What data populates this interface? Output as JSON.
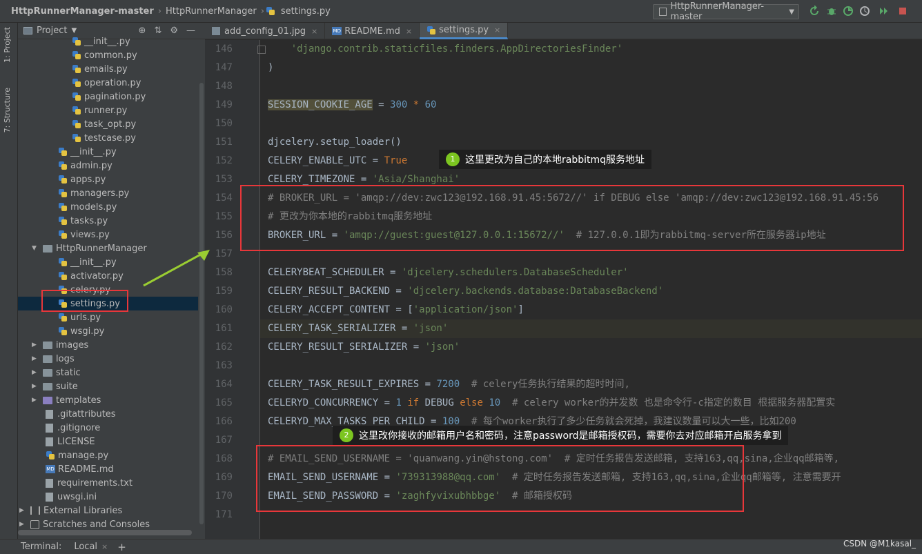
{
  "titlebar": {
    "breadcrumb": [
      "HttpRunnerManager-master",
      "HttpRunnerManager",
      "settings.py"
    ],
    "run_config": "HttpRunnerManager-master"
  },
  "left_strip": {
    "project_tab": "1: Project",
    "structure_tab": "7: Structure"
  },
  "project_panel": {
    "title": "Project",
    "items": [
      {
        "label": "__init__.py",
        "kind": "py",
        "indent": 78
      },
      {
        "label": "common.py",
        "kind": "py",
        "indent": 78
      },
      {
        "label": "emails.py",
        "kind": "py",
        "indent": 78
      },
      {
        "label": "operation.py",
        "kind": "py",
        "indent": 78
      },
      {
        "label": "pagination.py",
        "kind": "py",
        "indent": 78
      },
      {
        "label": "runner.py",
        "kind": "py",
        "indent": 78
      },
      {
        "label": "task_opt.py",
        "kind": "py",
        "indent": 78
      },
      {
        "label": "testcase.py",
        "kind": "py",
        "indent": 78
      },
      {
        "label": "__init__.py",
        "kind": "py",
        "indent": 58
      },
      {
        "label": "admin.py",
        "kind": "py",
        "indent": 58
      },
      {
        "label": "apps.py",
        "kind": "py",
        "indent": 58
      },
      {
        "label": "managers.py",
        "kind": "py",
        "indent": 58
      },
      {
        "label": "models.py",
        "kind": "py",
        "indent": 58
      },
      {
        "label": "tasks.py",
        "kind": "py",
        "indent": 58
      },
      {
        "label": "views.py",
        "kind": "py",
        "indent": 58
      },
      {
        "label": "HttpRunnerManager",
        "kind": "dir-open",
        "indent": 20
      },
      {
        "label": "__init__.py",
        "kind": "py",
        "indent": 58
      },
      {
        "label": "activator.py",
        "kind": "py",
        "indent": 58
      },
      {
        "label": "celery.py",
        "kind": "py",
        "indent": 58
      },
      {
        "label": "settings.py",
        "kind": "py",
        "indent": 58,
        "selected": true
      },
      {
        "label": "urls.py",
        "kind": "py",
        "indent": 58
      },
      {
        "label": "wsgi.py",
        "kind": "py",
        "indent": 58
      },
      {
        "label": "images",
        "kind": "dir",
        "indent": 20
      },
      {
        "label": "logs",
        "kind": "dir",
        "indent": 20
      },
      {
        "label": "static",
        "kind": "dir",
        "indent": 20
      },
      {
        "label": "suite",
        "kind": "dir",
        "indent": 20
      },
      {
        "label": "templates",
        "kind": "dir",
        "indent": 20
      },
      {
        "label": ".gitattributes",
        "kind": "file",
        "indent": 40
      },
      {
        "label": ".gitignore",
        "kind": "file",
        "indent": 40
      },
      {
        "label": "LICENSE",
        "kind": "file",
        "indent": 40
      },
      {
        "label": "manage.py",
        "kind": "py",
        "indent": 40
      },
      {
        "label": "README.md",
        "kind": "md",
        "indent": 40
      },
      {
        "label": "requirements.txt",
        "kind": "file",
        "indent": 40
      },
      {
        "label": "uwsgi.ini",
        "kind": "file",
        "indent": 40
      },
      {
        "label": "External Libraries",
        "kind": "lib",
        "indent": 2
      },
      {
        "label": "Scratches and Consoles",
        "kind": "scratch",
        "indent": 2
      }
    ]
  },
  "tabs": [
    {
      "label": "add_config_01.jpg",
      "icon": "image-icon"
    },
    {
      "label": "README.md",
      "icon": "markdown-icon"
    },
    {
      "label": "settings.py",
      "icon": "python-file-icon",
      "active": true
    }
  ],
  "editor": {
    "lines": [
      {
        "n": "146",
        "html": "    <span class=\"str\">'django.contrib.staticfiles.finders.AppDirectoriesFinder'</span>"
      },
      {
        "n": "147",
        "html": ")"
      },
      {
        "n": "148",
        "html": ""
      },
      {
        "n": "149",
        "html": "<span class=\"hl-bg\">SESSION_COOKIE_AGE</span> = <span class=\"num\">300</span> <span class=\"kw\">*</span> <span class=\"num\">60</span>"
      },
      {
        "n": "150",
        "html": ""
      },
      {
        "n": "151",
        "html": "djcelery.setup_loader()"
      },
      {
        "n": "152",
        "html": "CELERY_ENABLE_UTC = <span class=\"kw\">True</span>"
      },
      {
        "n": "153",
        "html": "CELERY_TIMEZONE = <span class=\"str\">'Asia/Shanghai'</span>"
      },
      {
        "n": "154",
        "html": "<span class=\"com\"># BROKER_URL = 'amqp://dev:zwc123@192.168.91.45:5672//' if DEBUG else 'amqp://dev:zwc123@192.168.91.45:56</span>"
      },
      {
        "n": "155",
        "html": "<span class=\"com\"># 更改为你本地的rabbitmq服务地址</span>"
      },
      {
        "n": "156",
        "html": "BROKER_URL = <span class=\"str\">'amqp://guest:guest@127.0.0.1:15672//'</span>  <span class=\"com\"># 127.0.0.1即为rabbitmq-server所在服务器ip地址</span>"
      },
      {
        "n": "157",
        "html": ""
      },
      {
        "n": "158",
        "html": "CELERYBEAT_SCHEDULER = <span class=\"str\">'djcelery.schedulers.DatabaseScheduler'</span>"
      },
      {
        "n": "159",
        "html": "CELERY_RESULT_BACKEND = <span class=\"str\">'djcelery.backends.database:DatabaseBackend'</span>"
      },
      {
        "n": "160",
        "html": "CELERY_ACCEPT_CONTENT = [<span class=\"str\">'application/json'</span>]"
      },
      {
        "n": "161",
        "html": "CELERY_TASK_SERIALIZER = <span class=\"str\">'json'</span>"
      },
      {
        "n": "162",
        "html": "CELERY_RESULT_SERIALIZER = <span class=\"str\">'json'</span>"
      },
      {
        "n": "163",
        "html": ""
      },
      {
        "n": "164",
        "html": "CELERY_TASK_RESULT_EXPIRES = <span class=\"num\">7200</span>  <span class=\"com\"># celery任务执行结果的超时时间,</span>"
      },
      {
        "n": "165",
        "html": "CELERYD_CONCURRENCY = <span class=\"num\">1</span> <span class=\"kw\">if</span> DEBUG <span class=\"kw\">else</span> <span class=\"num\">10</span>  <span class=\"com\"># celery worker的并发数 也是命令行-c指定的数目 根据服务器配置实</span>"
      },
      {
        "n": "166",
        "html": "CELERYD_MAX_TASKS_PER_CHILD = <span class=\"num\">100</span>  <span class=\"com\"># 每个worker执行了多少任务就会死掉，我建议数量可以大一些，比如200</span>"
      },
      {
        "n": "167",
        "html": ""
      },
      {
        "n": "168",
        "html": "<span class=\"com\"># EMAIL_SEND_USERNAME = 'quanwang.yin@hstong.com'  # 定时任务报告发送邮箱, 支持163,qq,sina,企业qq邮箱等,</span>"
      },
      {
        "n": "169",
        "html": "EMAIL_SEND_USERNAME = <span class=\"str\">'739313988@qq.com'</span>  <span class=\"com\"># 定时任务报告发送邮箱, 支持163,qq,sina,企业qq邮箱等, 注意需要开</span>"
      },
      {
        "n": "170",
        "html": "EMAIL_SEND_PASSWORD = <span class=\"str\">'zaghfyvixubhbbge'</span>  <span class=\"com\"># 邮箱授权码</span>"
      },
      {
        "n": "171",
        "html": ""
      }
    ]
  },
  "annotations": {
    "callout1_num": "1",
    "callout1_text": "这里更改为自己的本地rabbitmq服务地址",
    "callout2_num": "2",
    "callout2_text": "这里改你接收的邮箱用户名和密码，注意password是邮箱授权码，需要你去对应邮箱开启服务拿到"
  },
  "statusbar": {
    "terminal_label": "Terminal:",
    "local_tab": "Local",
    "watermark": "CSDN @M1kasal_"
  },
  "colors": {
    "annotation_red": "#e8373a",
    "annotation_green": "#7cc520"
  }
}
